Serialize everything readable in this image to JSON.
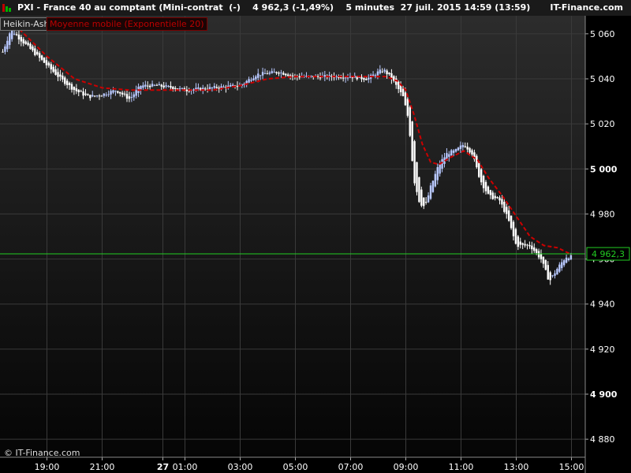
{
  "header": {
    "title": "PXI - France 40 au comptant (Mini-contrat  (-)    4 962,3 (-1,49%)    5 minutes  27 juil. 2015 14:59 (13:59)",
    "site": "IT-Finance.com",
    "logo_colors": [
      "#c00000",
      "#00b000",
      "#00b000"
    ]
  },
  "legend": {
    "type_label": "Heikin-Ashi",
    "ma_label": "Moyenne mobile (Exponentielle 20)"
  },
  "footer": {
    "copyright": "© IT-Finance.com"
  },
  "colors": {
    "up_candle": "#b8c8ff",
    "down_candle": "#ffffff",
    "ma_line": "#cc0000",
    "last_price_line": "#22cc22",
    "grid": "#3a3a3a"
  },
  "chart_data": {
    "type": "candlestick",
    "style": "Heikin-Ashi",
    "interval": "5 minutes",
    "last_price": 4962.3,
    "last_price_label": "4 962,3",
    "ylim": [
      4872,
      5068
    ],
    "y_ticks": [
      {
        "value": 5060,
        "label": "5 060",
        "bold": false
      },
      {
        "value": 5040,
        "label": "5 040",
        "bold": false
      },
      {
        "value": 5020,
        "label": "5 020",
        "bold": false
      },
      {
        "value": 5000,
        "label": "5 000",
        "bold": true
      },
      {
        "value": 4980,
        "label": "4 980",
        "bold": false
      },
      {
        "value": 4960,
        "label": "4 960",
        "bold": false
      },
      {
        "value": 4940,
        "label": "4 940",
        "bold": false
      },
      {
        "value": 4920,
        "label": "4 920",
        "bold": false
      },
      {
        "value": 4900,
        "label": "4 900",
        "bold": true
      },
      {
        "value": 4880,
        "label": "4 880",
        "bold": false
      }
    ],
    "x_ticks": [
      {
        "hour": 19.0,
        "label": "19:00",
        "bold": false
      },
      {
        "hour": 21.0,
        "label": "21:00",
        "bold": false
      },
      {
        "hour": 23.2,
        "label": "27",
        "bold": true
      },
      {
        "hour": 24.0,
        "label": "01:00",
        "bold": false
      },
      {
        "hour": 26.0,
        "label": "03:00",
        "bold": false
      },
      {
        "hour": 28.0,
        "label": "05:00",
        "bold": false
      },
      {
        "hour": 30.0,
        "label": "07:00",
        "bold": false
      },
      {
        "hour": 32.0,
        "label": "09:00",
        "bold": false
      },
      {
        "hour": 34.0,
        "label": "11:00",
        "bold": false
      },
      {
        "hour": 36.0,
        "label": "13:00",
        "bold": false
      },
      {
        "hour": 38.0,
        "label": "15:00",
        "bold": false
      }
    ],
    "x_range_hours": [
      17.3,
      38.5
    ],
    "price_path": [
      [
        17.4,
        5052
      ],
      [
        17.7,
        5062
      ],
      [
        18.0,
        5058
      ],
      [
        18.5,
        5052
      ],
      [
        19.0,
        5046
      ],
      [
        19.5,
        5040
      ],
      [
        20.0,
        5035
      ],
      [
        20.5,
        5032
      ],
      [
        21.0,
        5033
      ],
      [
        21.5,
        5035
      ],
      [
        22.0,
        5031
      ],
      [
        22.4,
        5037
      ],
      [
        23.0,
        5037
      ],
      [
        23.6,
        5036
      ],
      [
        24.0,
        5035
      ],
      [
        25.0,
        5036
      ],
      [
        26.0,
        5037
      ],
      [
        26.6,
        5042
      ],
      [
        27.4,
        5043
      ],
      [
        28.0,
        5041
      ],
      [
        29.0,
        5041
      ],
      [
        30.0,
        5041
      ],
      [
        30.6,
        5040
      ],
      [
        31.0,
        5043
      ],
      [
        31.2,
        5044
      ],
      [
        31.5,
        5040
      ],
      [
        31.9,
        5032
      ],
      [
        32.1,
        5022
      ],
      [
        32.3,
        4995
      ],
      [
        32.5,
        4985
      ],
      [
        32.7,
        4983
      ],
      [
        32.9,
        4992
      ],
      [
        33.2,
        5002
      ],
      [
        33.5,
        5007
      ],
      [
        33.8,
        5008
      ],
      [
        34.1,
        5011
      ],
      [
        34.4,
        5007
      ],
      [
        34.7,
        4995
      ],
      [
        35.0,
        4988
      ],
      [
        35.4,
        4986
      ],
      [
        35.7,
        4978
      ],
      [
        36.0,
        4966
      ],
      [
        36.5,
        4966
      ],
      [
        36.9,
        4960
      ],
      [
        37.2,
        4950
      ],
      [
        37.5,
        4956
      ],
      [
        37.8,
        4961
      ],
      [
        38.0,
        4961
      ]
    ],
    "ma_path": [
      [
        17.4,
        5066
      ],
      [
        18.0,
        5062
      ],
      [
        19.0,
        5050
      ],
      [
        20.0,
        5040
      ],
      [
        21.0,
        5036
      ],
      [
        22.0,
        5035
      ],
      [
        23.0,
        5035
      ],
      [
        24.0,
        5035
      ],
      [
        25.0,
        5035
      ],
      [
        26.0,
        5037
      ],
      [
        27.0,
        5040
      ],
      [
        28.0,
        5041
      ],
      [
        29.0,
        5041
      ],
      [
        30.0,
        5041
      ],
      [
        30.7,
        5041
      ],
      [
        31.3,
        5041
      ],
      [
        31.7,
        5039
      ],
      [
        32.0,
        5035
      ],
      [
        32.3,
        5024
      ],
      [
        32.6,
        5011
      ],
      [
        32.9,
        5003
      ],
      [
        33.2,
        5002
      ],
      [
        33.6,
        5005
      ],
      [
        34.1,
        5008
      ],
      [
        34.6,
        5004
      ],
      [
        35.0,
        4996
      ],
      [
        35.5,
        4988
      ],
      [
        36.0,
        4979
      ],
      [
        36.5,
        4970
      ],
      [
        37.0,
        4966
      ],
      [
        37.5,
        4965
      ],
      [
        38.0,
        4962
      ]
    ]
  }
}
